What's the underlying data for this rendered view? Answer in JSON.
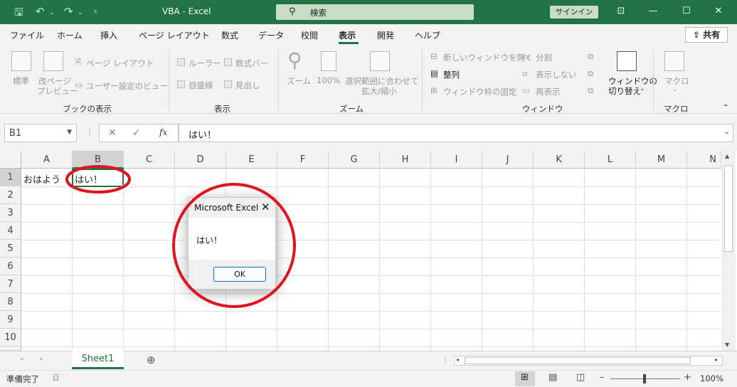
{
  "titlebar": {
    "title": "VBA  -  Excel",
    "search": "検索",
    "signin": "サインイン"
  },
  "menu": {
    "tabs": [
      "ファイル",
      "ホーム",
      "挿入",
      "ページ レイアウト",
      "数式",
      "データ",
      "校閲",
      "表示",
      "開発",
      "ヘルプ"
    ],
    "active": "表示",
    "share": "共有"
  },
  "ribbon": {
    "book_views": {
      "normal": "標準",
      "pagebreak1": "改ページ",
      "pagebreak2": "プレビュー",
      "page_layout": "ページ レイアウト",
      "custom_views": "ユーザー設定のビュー",
      "group": "ブックの表示"
    },
    "show": {
      "ruler": "ルーラー",
      "formula_bar": "数式バー",
      "gridlines": "目盛線",
      "headings": "見出し",
      "group": "表示"
    },
    "zoom": {
      "zoom": "ズーム",
      "hundred": "100%",
      "selection1": "選択範囲に合わせて",
      "selection2": "拡大/縮小",
      "group": "ズーム"
    },
    "window": {
      "new_window": "新しいウィンドウを開く",
      "arrange": "整列",
      "freeze": "ウィンドウ枠の固定",
      "split": "分割",
      "hide": "表示しない",
      "unhide": "再表示",
      "switch1": "ウィンドウの",
      "switch2": "切り替え",
      "group": "ウィンドウ"
    },
    "macros": {
      "macro": "マクロ",
      "group": "マクロ"
    }
  },
  "formula_bar": {
    "name_box": "B1",
    "fx": "fx",
    "value": "はい！"
  },
  "grid": {
    "columns": [
      "A",
      "B",
      "C",
      "D",
      "E",
      "F",
      "G",
      "H",
      "I",
      "J",
      "K",
      "L",
      "M",
      "N"
    ],
    "rows": [
      "1",
      "2",
      "3",
      "4",
      "5",
      "6",
      "7",
      "8",
      "9",
      "10"
    ],
    "cells": {
      "A1": "おはよう",
      "B1": "はい！"
    }
  },
  "sheet_tab": "Sheet1",
  "status": {
    "ready": "準備完了",
    "zoom": "100%"
  },
  "dialog": {
    "title": "Microsoft Excel",
    "message": "はい！",
    "ok": "OK"
  },
  "annotation_color": "#e0141e"
}
